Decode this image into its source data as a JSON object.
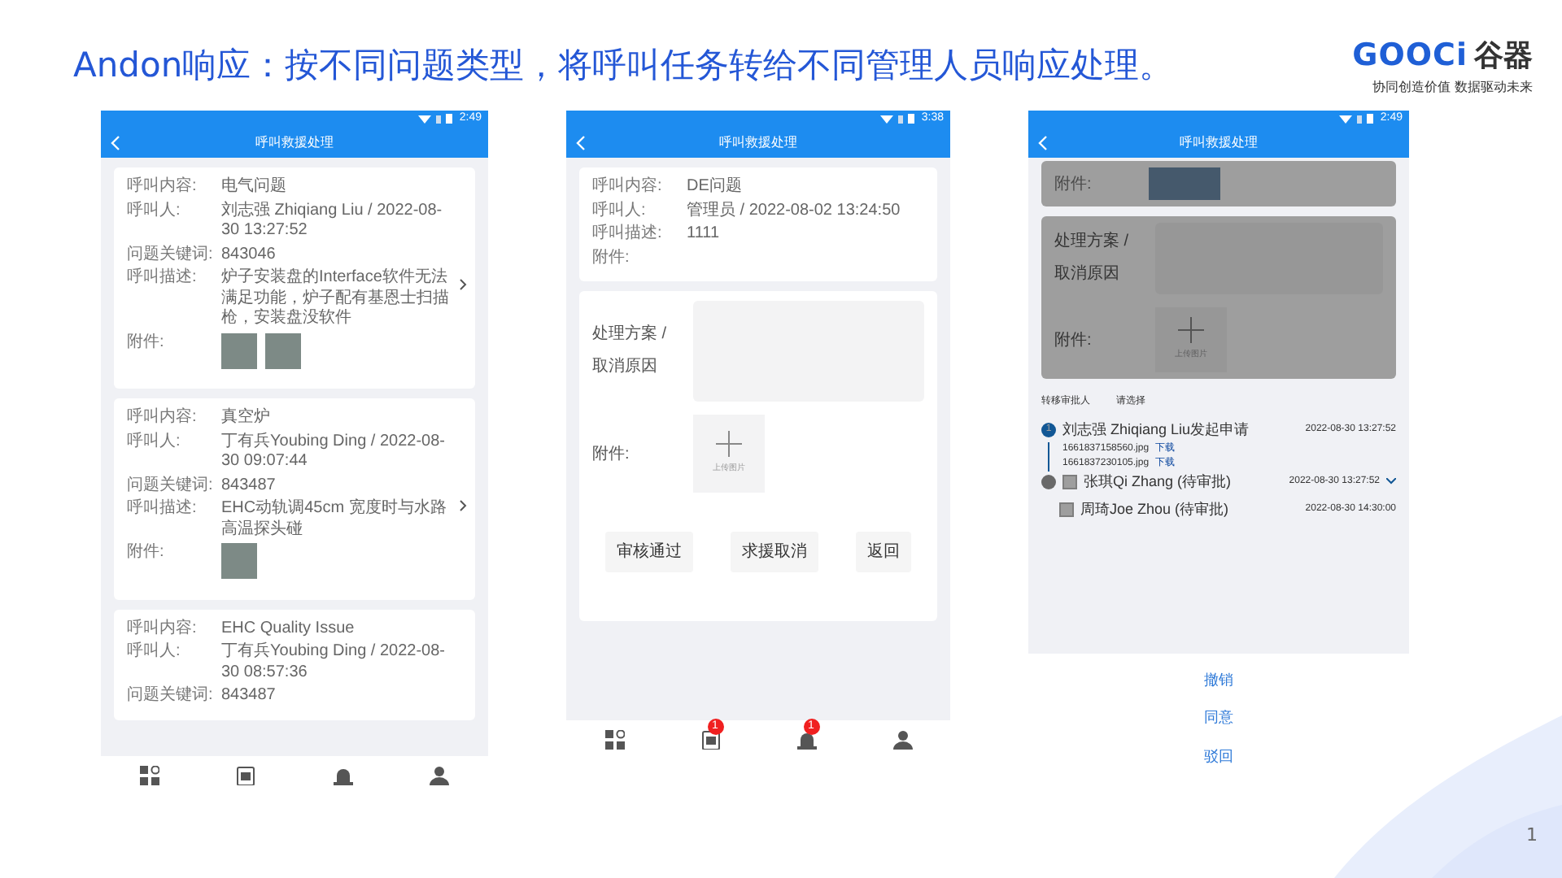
{
  "title": "Andon响应：按不同问题类型，将呼叫任务转给不同管理人员响应处理。",
  "logo": {
    "wordmark": "GOOCi",
    "name": "谷器",
    "tagline": "协同创造价值 数据驱动未来"
  },
  "page_number": "1",
  "phones": [
    {
      "time": "2:49",
      "header_title": "呼叫救援处理",
      "cards": [
        {
          "fields": [
            {
              "label": "呼叫内容:",
              "value": "电气问题"
            },
            {
              "label": "呼叫人:",
              "value": "刘志强 Zhiqiang Liu / 2022-08-30 13:27:52"
            },
            {
              "label": "问题关键词:",
              "value": "843046"
            },
            {
              "label": "呼叫描述:",
              "value": "炉子安装盘的Interface软件无法满足功能，炉子配有基恩士扫描枪，安装盘没软件"
            },
            {
              "label": "附件:",
              "photos": [
                {
                  "kind": "photo"
                },
                {
                  "kind": "photo"
                }
              ]
            }
          ]
        },
        {
          "fields": [
            {
              "label": "呼叫内容:",
              "value": "真空炉"
            },
            {
              "label": "呼叫人:",
              "value": "丁有兵Youbing Ding / 2022-08-30 09:07:44"
            },
            {
              "label": "问题关键词:",
              "value": "843487"
            },
            {
              "label": "呼叫描述:",
              "value": "EHC动轨调45cm 宽度时与水路高温探头碰"
            },
            {
              "label": "附件:",
              "photos": [
                {
                  "kind": "photo"
                }
              ]
            }
          ]
        },
        {
          "fields": [
            {
              "label": "呼叫内容:",
              "value": "EHC Quality Issue"
            },
            {
              "label": "呼叫人:",
              "value": "丁有兵Youbing Ding / 2022-08-30 08:57:36"
            },
            {
              "label": "问题关键词:",
              "value": "843487"
            }
          ]
        }
      ],
      "nav": [
        {
          "kind": "apps"
        },
        {
          "kind": "tasks"
        },
        {
          "kind": "alerts"
        },
        {
          "kind": "profile"
        }
      ]
    },
    {
      "time": "3:38",
      "header_title": "呼叫救援处理",
      "cards": [
        {
          "fields": [
            {
              "label": "呼叫内容:",
              "value": "DE问题"
            },
            {
              "label": "呼叫人:",
              "value": "管理员 / 2022-08-02 13:24:50"
            },
            {
              "label": "呼叫描述:",
              "value": "1111"
            },
            {
              "label": "附件:"
            }
          ]
        }
      ],
      "form": {
        "reason_label": "处理方案 / 取消原因",
        "attach_label": "附件:",
        "upload_hint": "上传图片",
        "buttons": [
          "审核通过",
          "求援取消",
          "返回"
        ]
      },
      "nav": [
        {
          "kind": "apps"
        },
        {
          "kind": "tasks",
          "badge": "1"
        },
        {
          "kind": "alerts",
          "badge": "1"
        },
        {
          "kind": "profile"
        }
      ]
    },
    {
      "time": "2:49",
      "header_title": "呼叫救援处理",
      "partial_attachment": {
        "label": "附件:"
      },
      "form": {
        "reason_label": "处理方案 / 取消原因",
        "attach_label": "附件:",
        "upload_hint": "上传图片",
        "transfer_label": "转移审批人",
        "transfer_value": "请选择"
      },
      "timeline": [
        {
          "active": true,
          "step": "1",
          "title": "刘志强 Zhiqiang Liu发起申请",
          "time": "2022-08-30 13:27:52",
          "files": [
            {
              "name": "1661837158560.jpg",
              "link": "下载"
            },
            {
              "name": "1661837230105.jpg",
              "link": "下载"
            }
          ]
        },
        {
          "active": false,
          "approvers": [
            {
              "name": "张琪Qi Zhang (待审批)",
              "time": "2022-08-30 13:27:52",
              "checked": false
            },
            {
              "name": "周琦Joe Zhou (待审批)",
              "time": "2022-08-30 14:30:00",
              "checked": false
            }
          ]
        }
      ],
      "sheet": [
        "撤销",
        "同意",
        "驳回"
      ]
    }
  ]
}
